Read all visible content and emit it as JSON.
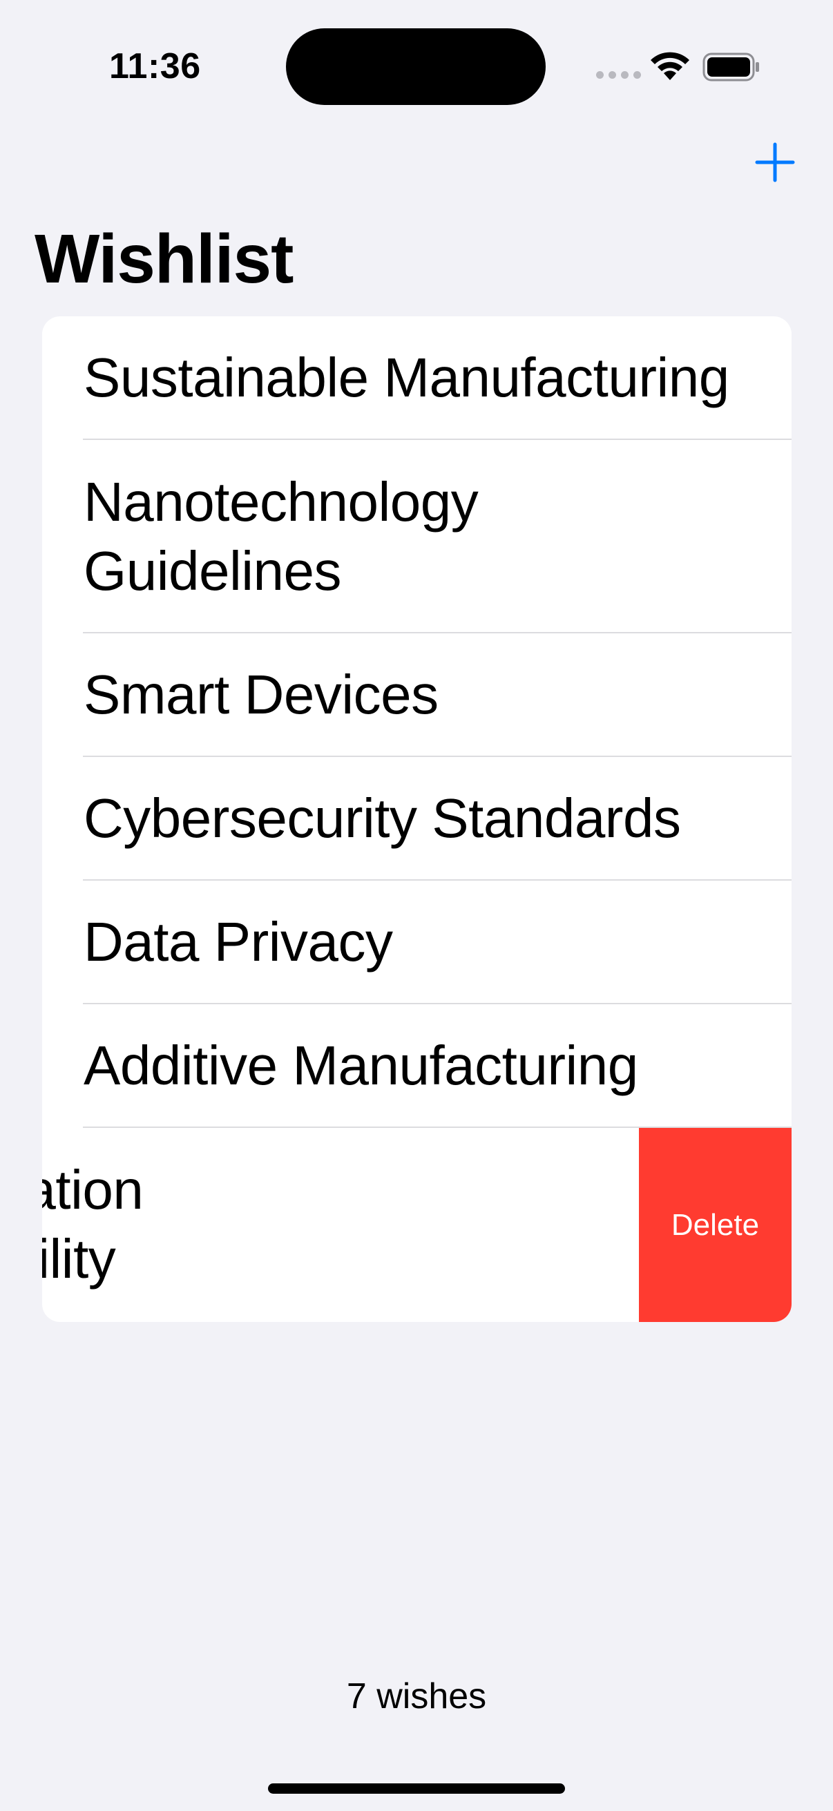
{
  "status_bar": {
    "time": "11:36"
  },
  "nav": {
    "title": "Wishlist",
    "add_icon": "plus-icon"
  },
  "list": {
    "items": [
      {
        "label": "Sustainable Manufacturing"
      },
      {
        "label": "Nanotechnology\nGuidelines"
      },
      {
        "label": "Smart Devices"
      },
      {
        "label": "Cybersecurity Standards"
      },
      {
        "label": "Data Privacy"
      },
      {
        "label": "Additive Manufacturing"
      }
    ],
    "swiped_item": {
      "label": "sportation\nainability",
      "delete_label": "Delete"
    }
  },
  "footer": {
    "count_text": "7 wishes"
  },
  "colors": {
    "accent": "#007aff",
    "destructive": "#ff3b30",
    "background": "#f2f2f7"
  }
}
